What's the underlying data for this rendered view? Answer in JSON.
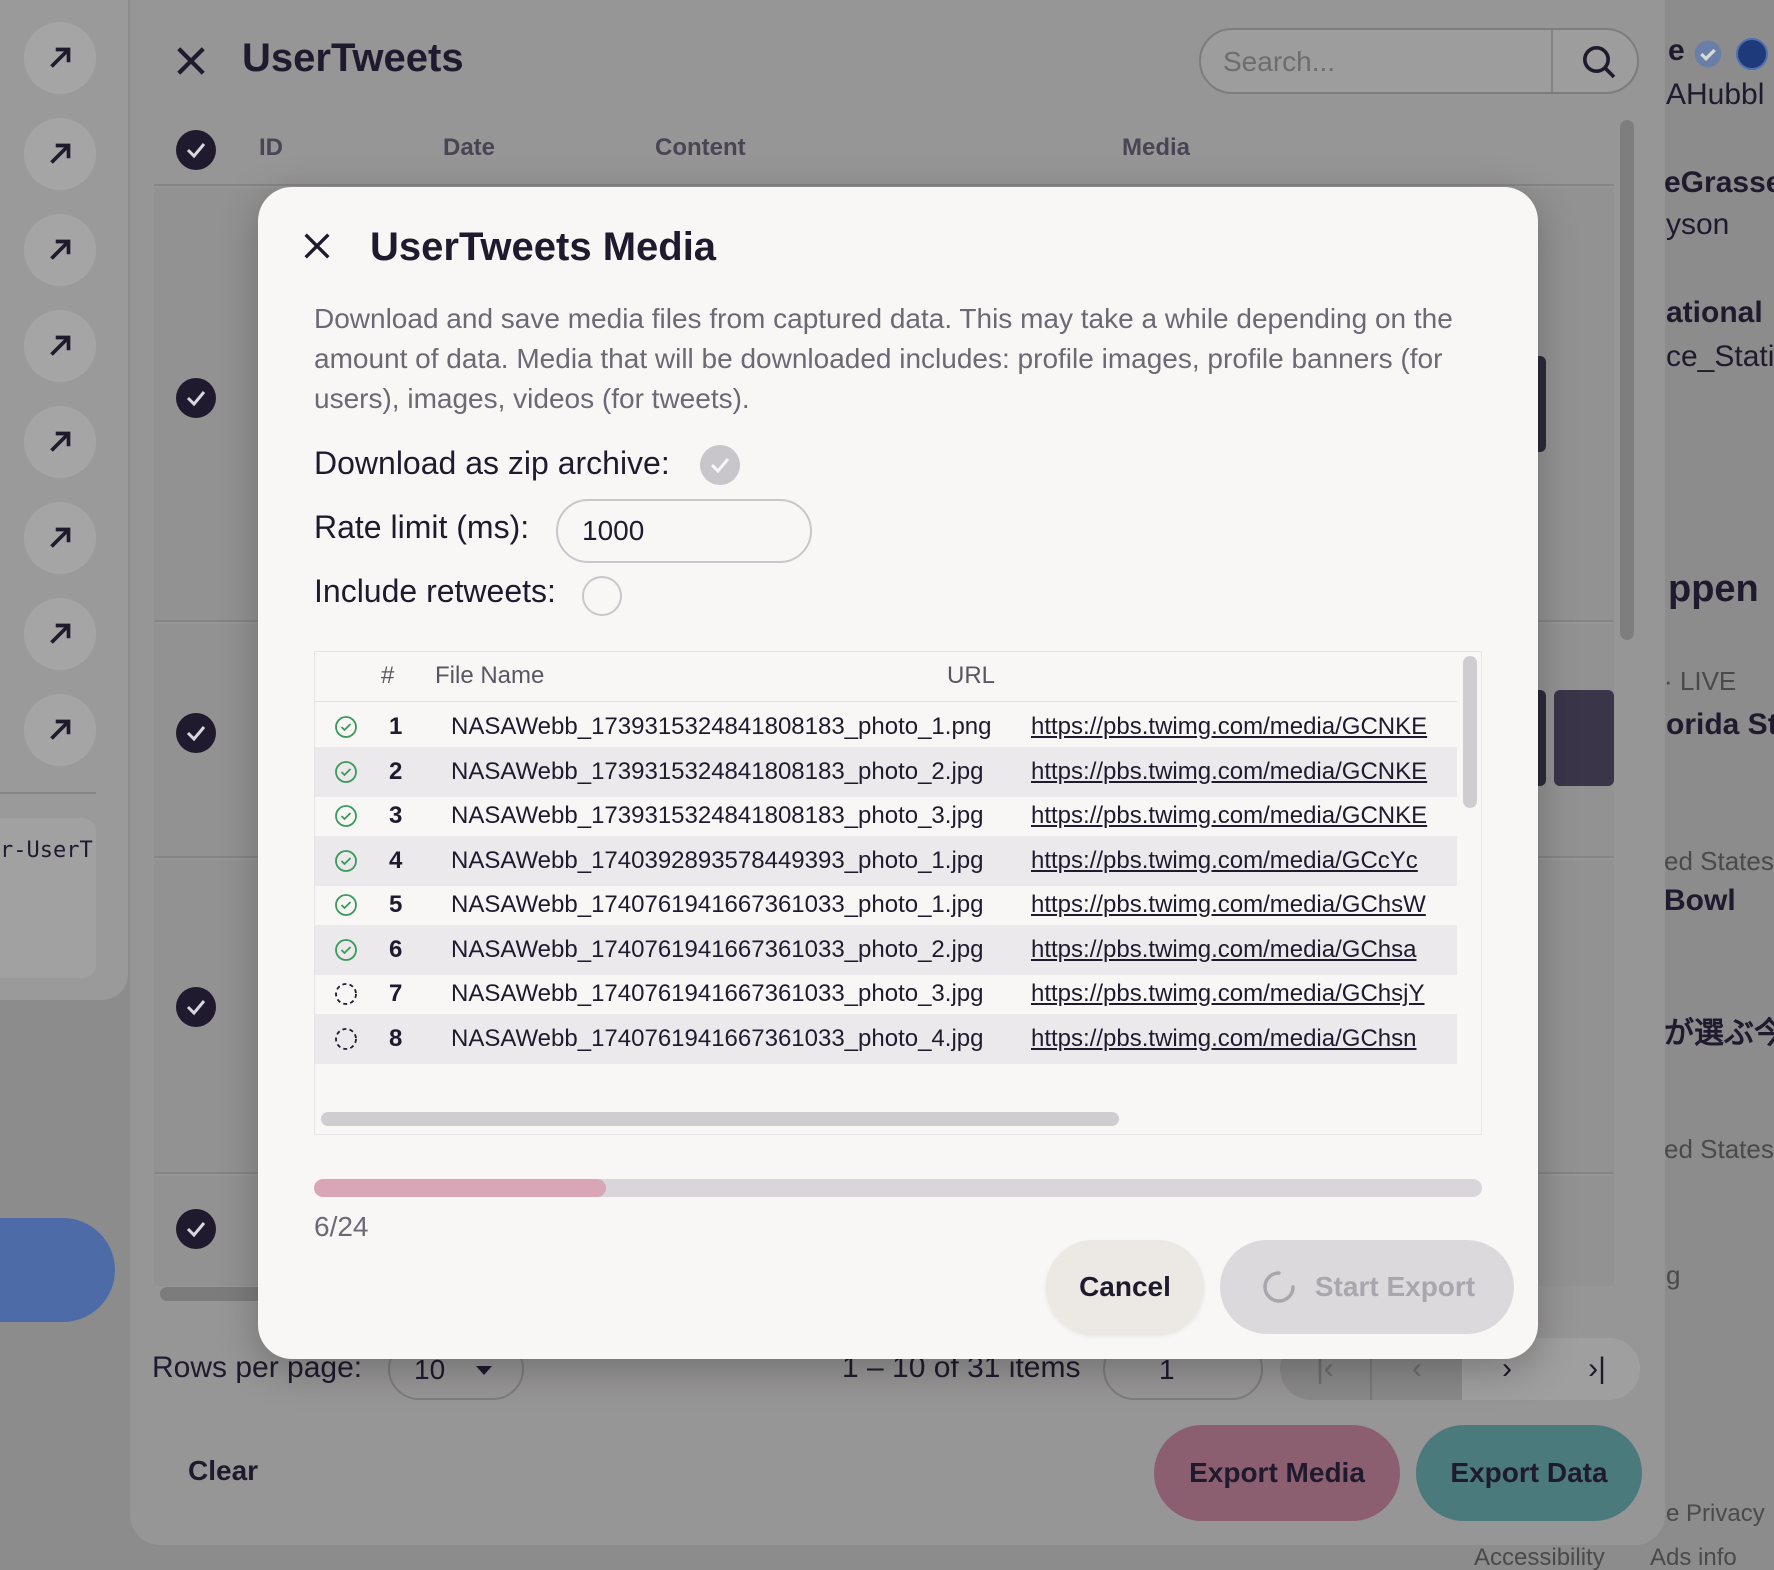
{
  "background": {
    "title": "UserTweets",
    "search_placeholder": "Search...",
    "columns": [
      "ID",
      "Date",
      "Content",
      "Media"
    ],
    "rows_per_page_label": "Rows per page:",
    "rows_per_page_value": "10",
    "range_text": "1 – 10 of 31 items",
    "page_value": "1",
    "clear_label": "Clear",
    "export_media_label": "Export Media",
    "export_data_label": "Export Data",
    "left_card_text": "r-UserT",
    "right_panel": {
      "user1_name": "e",
      "user1_handle": "AHubbl",
      "user2_name": "eGrasse",
      "user2_handle": "yson",
      "user3_name": "ational",
      "user3_handle": "ce_Static",
      "happening": "ppen",
      "live_label": "· LIVE",
      "trend1": "orida St",
      "trend2_context": "ed States",
      "trend2": "Bowl",
      "trend3": "が選ぶ今",
      "trend4_context": "ed States",
      "trend5": "g",
      "footer1": "e  Privacy",
      "footer2_a": "Accessibility",
      "footer2_b": "Ads info"
    }
  },
  "modal": {
    "title": "UserTweets Media",
    "description": "Download and save media files from captured data. This may take a while depending on the amount of data. Media that will be downloaded includes: profile images, profile banners (for users), images, videos (for tweets).",
    "zip_label": "Download as zip archive:",
    "zip_checked": true,
    "rate_limit_label": "Rate limit (ms):",
    "rate_limit_value": "1000",
    "retweets_label": "Include retweets:",
    "retweets_checked": false,
    "table_headers": {
      "num": "#",
      "file_name": "File Name",
      "url": "URL"
    },
    "files": [
      {
        "status": "done",
        "num": "1",
        "name": "NASAWebb_1739315324841808183_photo_1.png",
        "url": "https://pbs.twimg.com/media/GCNKE"
      },
      {
        "status": "done",
        "num": "2",
        "name": "NASAWebb_1739315324841808183_photo_2.jpg",
        "url": "https://pbs.twimg.com/media/GCNKE"
      },
      {
        "status": "done",
        "num": "3",
        "name": "NASAWebb_1739315324841808183_photo_3.jpg",
        "url": "https://pbs.twimg.com/media/GCNKE"
      },
      {
        "status": "done",
        "num": "4",
        "name": "NASAWebb_1740392893578449393_photo_1.jpg",
        "url": "https://pbs.twimg.com/media/GCcYc"
      },
      {
        "status": "done",
        "num": "5",
        "name": "NASAWebb_1740761941667361033_photo_1.jpg",
        "url": "https://pbs.twimg.com/media/GChsW"
      },
      {
        "status": "done",
        "num": "6",
        "name": "NASAWebb_1740761941667361033_photo_2.jpg",
        "url": "https://pbs.twimg.com/media/GChsa"
      },
      {
        "status": "pending",
        "num": "7",
        "name": "NASAWebb_1740761941667361033_photo_3.jpg",
        "url": "https://pbs.twimg.com/media/GChsjY"
      },
      {
        "status": "pending",
        "num": "8",
        "name": "NASAWebb_1740761941667361033_photo_4.jpg",
        "url": "https://pbs.twimg.com/media/GChsn"
      }
    ],
    "progress": {
      "done": 6,
      "total": 24,
      "text": "6/24"
    },
    "cancel_label": "Cancel",
    "start_label": "Start Export",
    "colors": {
      "progress_fill": "#d9a6b8",
      "done_icon": "#3a9a5b",
      "title": "#1f1a2e"
    }
  }
}
